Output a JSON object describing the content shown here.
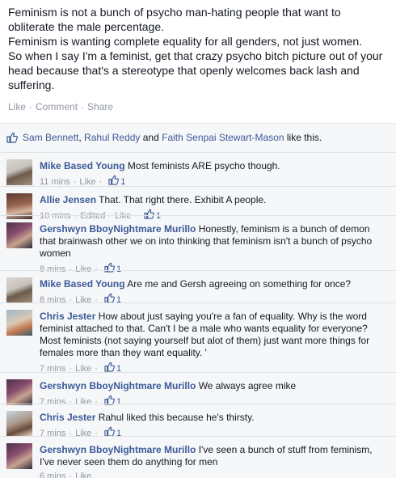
{
  "post": {
    "lines": [
      "Feminism is not a bunch of psycho man-hating people that want to",
      "obliterate the male percentage.",
      "Feminism is wanting complete equality for all genders, not just women.",
      "So when I say I'm a feminist, get that crazy psycho bitch picture out of your",
      "head because that's a stereotype that openly welcomes back lash and",
      "suffering."
    ],
    "actions": {
      "like": "Like",
      "comment": "Comment",
      "share": "Share",
      "sep": "·"
    }
  },
  "likes": {
    "names": [
      "Sam Bennett",
      "Rahul Reddy",
      "Faith Senpai Stewart-Mason"
    ],
    "sep_comma": ", ",
    "sep_and": " and ",
    "suffix": " like this."
  },
  "comments": [
    {
      "author": "Mike Based Young",
      "text": " Most feminists ARE psycho though.",
      "time": "11 mins",
      "edited": null,
      "like_label": "Like",
      "likes": "1",
      "avatar": "av-mike"
    },
    {
      "author": "Allie Jensen",
      "text": " That. That right there. Exhibit A people.",
      "time": "10 mins",
      "edited": "Edited",
      "like_label": "Like",
      "likes": "1",
      "avatar": "av-allie"
    },
    {
      "author": "Gershwyn BboyNightmare Murillo",
      "text": " Honestly, feminism is a bunch of demon that brainwash other we on into thinking that feminism isn't a bunch of psycho women",
      "time": "8 mins",
      "edited": null,
      "like_label": "Like",
      "likes": "1",
      "avatar": "av-gersh"
    },
    {
      "author": "Mike Based Young",
      "text": " Are me and Gersh agreeing on something for once?",
      "time": "8 mins",
      "edited": null,
      "like_label": "Like",
      "likes": "1",
      "avatar": "av-mike"
    },
    {
      "author": "Chris Jester",
      "text": " How about just saying you're a fan of equality. Why is the word feminist attached to that. Can't I be a male who wants equality for everyone? Most feminists (not saying yourself but alot of them) just want more things for females more than they want equality. '",
      "time": "7 mins",
      "edited": null,
      "like_label": "Like",
      "likes": "1",
      "avatar": "av-chrisj"
    },
    {
      "author": "Gershwyn BboyNightmare Murillo",
      "text": " We always agree mike",
      "time": "7 mins",
      "edited": null,
      "like_label": "Like",
      "likes": "1",
      "avatar": "av-gersh"
    },
    {
      "author": "Chris Jester",
      "text": " Rahul liked this because he's thirsty.",
      "time": "7 mins",
      "edited": null,
      "like_label": "Like",
      "likes": "1",
      "avatar": "av-chrisj2"
    },
    {
      "author": "Gershwyn BboyNightmare Murillo",
      "text": " I've seen a bunch of stuff from feminism, I've never seen them do anything for men",
      "time": "6 mins",
      "edited": null,
      "like_label": "Like",
      "likes": null,
      "avatar": "av-gersh"
    }
  ],
  "colors": {
    "link": "#3b5998",
    "meta": "#9197a3",
    "ufi_bg": "#f6f7f8",
    "text": "#141823"
  },
  "icons": {
    "like_thumb": "thumbs-up-icon"
  }
}
